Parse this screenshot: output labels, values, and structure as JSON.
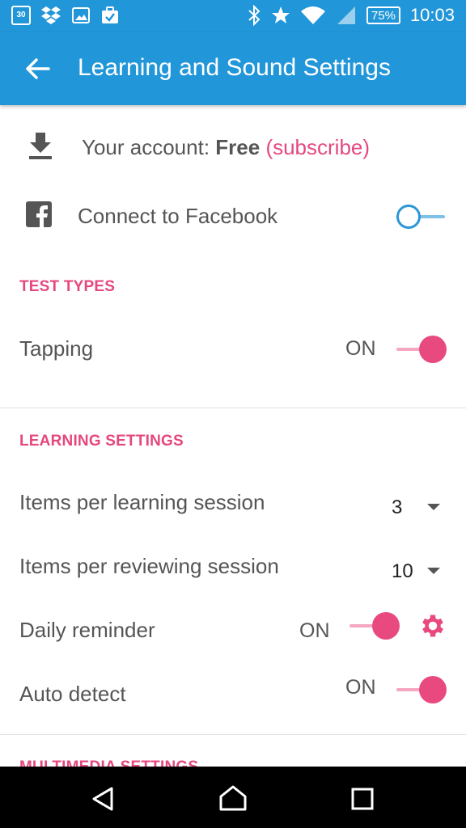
{
  "status_bar": {
    "calendar_day": "30",
    "battery": "75%",
    "time": "10:03"
  },
  "app_bar": {
    "title": "Learning and Sound Settings",
    "back_icon": "arrow-left-icon"
  },
  "account": {
    "prefix": "Your account: ",
    "plan": "Free",
    "subscribe": "(subscribe)",
    "icon": "download-icon"
  },
  "facebook": {
    "label": "Connect to Facebook",
    "enabled": false,
    "icon": "facebook-icon"
  },
  "test_types": {
    "header": "TEST TYPES",
    "tapping": {
      "label": "Tapping",
      "state": "ON",
      "enabled": true
    }
  },
  "learning_settings": {
    "header": "LEARNING SETTINGS",
    "items_learning": {
      "label": "Items per learning session",
      "value": "3"
    },
    "items_reviewing": {
      "label": "Items per reviewing session",
      "value": "10"
    },
    "daily_reminder": {
      "label": "Daily reminder",
      "state": "ON",
      "enabled": true,
      "settings_icon": "gear-icon"
    },
    "auto_detect": {
      "label": "Auto detect",
      "state": "ON",
      "enabled": true
    }
  },
  "multimedia_settings": {
    "header": "MULTIMEDIA SETTINGS"
  },
  "colors": {
    "primary": "#2196d9",
    "accent": "#e5477f"
  }
}
